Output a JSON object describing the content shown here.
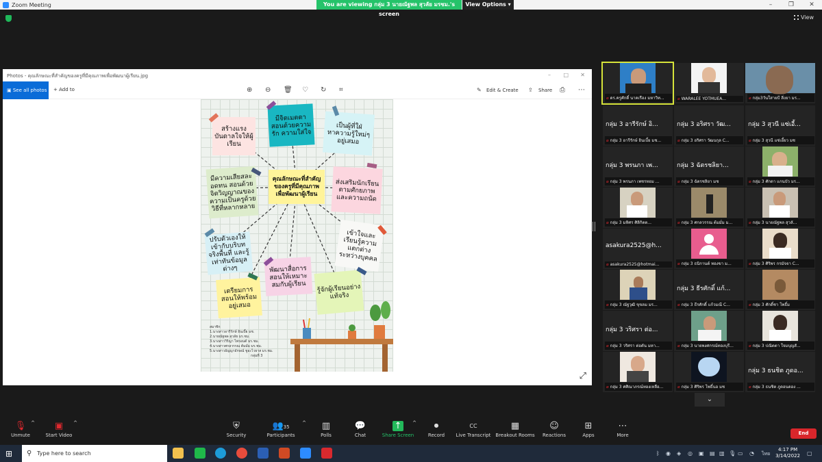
{
  "window": {
    "title": "Zoom Meeting",
    "viewing_banner": "You are viewing กลุ่ม 3 นายณัฐพล สุวลัย มรชม.'s screen",
    "view_options": "View Options",
    "view_label": "View"
  },
  "photos": {
    "title": "Photos - คุณลักษณะที่สำคัญของครูที่มีคุณภาพเพื่อพัฒนาผู้เรียน.jpg",
    "see_all": "See all photos",
    "add_to": "Add to",
    "edit_create": "Edit & Create",
    "share": "Share"
  },
  "poster": {
    "center": "คุณลักษณะที่สำคัญของครูที่มีคุณภาพเพื่อพัฒนาผู้เรียน",
    "notes": [
      "สร้างแรงบันดาลใจให้ผู้เรียน",
      "มีจิตเมตตาสอนด้วยความรัก ความใส่ใจ",
      "เป็นผู้ที่ใฝ่หาความรู้ใหม่ๆ อยู่เสมอ",
      "มีความเสียสละ อดทน สอนด้วยจิตวิญญาณของความเป็นครูด้วยวิธีที่หลากหลาย",
      "ส่งเสริมนักเรียนตามศักยภาพและความถนัด",
      "ปรับตัวเองให้เข้ากับบริบทจริงพื้นที่ และรู้เท่าทันข้อมูลต่างๆ",
      "เข้าใจและเรียนรู้ความแตกต่างระหว่างบุคคล",
      "พัฒนาสื่อการสอนให้เหมาะสมกับผู้เรียน",
      "เตรียมการสอนให้พร้อมอยู่เสมอ",
      "รู้จักผู้เรียนอย่างแท้จริง"
    ],
    "members": [
      "สมาชิก",
      "1.นางสาวอารีรักษ์ อินเบี้ย มช.",
      "2.นายณัฐพล สุวลัย มร.ชม.",
      "3.นางสาววิริญา ไพรอนต์ มร.ชม.",
      "4.นางสาวศกลวรรณ ต้มมั่ม มร.ชม.",
      "5.นางสาวอัญญาอักษณ์ ชูอะไวยาส มร.ชม.",
      "กลุ่มที่ 3"
    ]
  },
  "participants": [
    {
      "name": "",
      "caption": "ดร.ครูศักดิ์ นาคเรือง มหาวิท..."
    },
    {
      "name": "",
      "caption": "WARALEE YOTMUEA..."
    },
    {
      "name": "",
      "caption": "กลุ่ม3วันใสายบี สิ่งยา มร..."
    },
    {
      "name": "กลุ่ม 3 อารีรักษ์ อิ...",
      "caption": "กลุ่ม 3 อารีรักษ์ อินเบี้ย มช..."
    },
    {
      "name": "กลุ่ม 3 อริศรา วัฒ...",
      "caption": "กลุ่ม 3 อริศรา วัฒนกุล C..."
    },
    {
      "name": "กลุ่ม 3 สุวนี แซ่เอี้...",
      "caption": "กลุ่ม 3 สุวนี แซ่เอี้ยว มช"
    },
    {
      "name": "กลุ่ม 3 พรนภา เพ...",
      "caption": "กลุ่ม 3 พรนภา เพชรหอม ..."
    },
    {
      "name": "กลุ่ม 3 ฉัตรชลิยา...",
      "caption": "กลุ่ม 3 ฉัตรชลิยา มช"
    },
    {
      "name": "",
      "caption": "กลุ่ม 3 ศักดา แกนบัว มร..."
    },
    {
      "name": "",
      "caption": "กลุ่ม 3 มหิศร ศิลิกิตต..."
    },
    {
      "name": "",
      "caption": "กลุ่ม 3 ศกลวรรณ ต้มมั่ม ม..."
    },
    {
      "name": "",
      "caption": "กลุ่ม 3 นายณัฐพล สุวลั..."
    },
    {
      "name": "asakura2525@h...",
      "caption": "asakura2525@hotmai..."
    },
    {
      "name": "",
      "caption": "กลุ่ม 3 ธนิกานต์ ทองขา ม..."
    },
    {
      "name": "",
      "caption": "กลุ่ม 3 ศิริพร กรมัจจา C..."
    },
    {
      "name": "",
      "caption": "กลุ่ม 3 ณัฐวุฒิ ขุขลม มร..."
    },
    {
      "name": "กลุ่ม 3 ธีรศักดิ์ แก้...",
      "caption": "กลุ่ม 3 ธีรศักดิ์ แก้วมณี C..."
    },
    {
      "name": "",
      "caption": "กลุ่ม 3 ศักดิ์ชา โพธิ์ม"
    },
    {
      "name": "กลุ่ม 3 วริศรา ต่อ...",
      "caption": "กลุ่ม 3 วริศรา ต่อตัน มหา..."
    },
    {
      "name": "",
      "caption": "กลุ่ม 3 นายพงศกรณ์ทองบุรี..."
    },
    {
      "name": "",
      "caption": "กลุ่ม 3 ปณิตตา ใจมบุญสั..."
    },
    {
      "name": "",
      "caption": "กลุ่ม 3 ศศิณาภรณ์ทองเหลือ..."
    },
    {
      "name": "",
      "caption": "กลุ่ม 3 ศิริพร โพธิ์นอ มช"
    },
    {
      "name": "กลุ่ม 3 ธนชิต ภูดอ...",
      "caption": "กลุ่ม 3 ธนชิต ภูดอนดอง ..."
    }
  ],
  "controls": {
    "unmute": "Unmute",
    "start_video": "Start Video",
    "security": "Security",
    "participants": "Participants",
    "participants_count": "35",
    "polls": "Polls",
    "chat": "Chat",
    "share_screen": "Share Screen",
    "record": "Record",
    "live_transcript": "Live Transcript",
    "breakout_rooms": "Breakout Rooms",
    "reactions": "Reactions",
    "apps": "Apps",
    "more": "More",
    "end": "End"
  },
  "taskbar": {
    "search_placeholder": "Type here to search",
    "lang": "ไทย",
    "time": "4:17 PM",
    "date": "3/14/2022"
  }
}
